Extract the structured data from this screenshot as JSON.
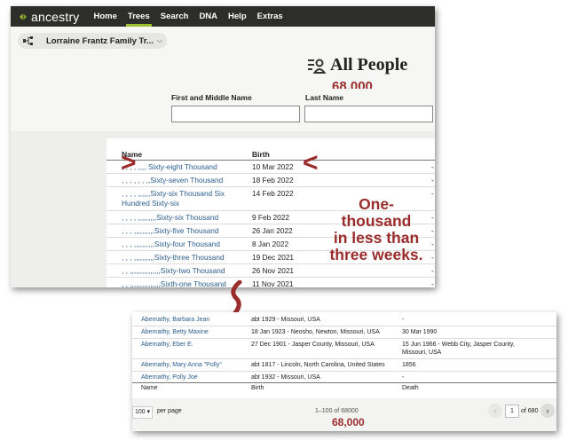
{
  "navbar": {
    "logo_text": "ancestry",
    "items": [
      "Home",
      "Trees",
      "Search",
      "DNA",
      "Help",
      "Extras"
    ],
    "active": "Trees"
  },
  "tree": {
    "name": "Lorraine Frantz Family Tr...",
    "chevron": "⌵"
  },
  "page": {
    "title": "All People",
    "count_annotation": "68,000"
  },
  "search": {
    "first_label": "First and Middle Name",
    "first_value": "",
    "last_label": "Last Name",
    "last_value": ""
  },
  "table": {
    "headers": {
      "name": "Name",
      "birth": "Birth",
      "death": ""
    },
    "rows": [
      {
        "name": ", , , , ,,,, Sixty-eight Thousand",
        "birth": "10 Mar 2022",
        "death": "-"
      },
      {
        "name": ", , , , , , ,,Sixty-seven Thousand",
        "birth": "18 Feb 2022",
        "death": "-"
      },
      {
        "name": ", , , , ,,,,,,Sixty-six Thousand Six Hundred Sixty-six",
        "birth": "14 Feb 2022",
        "death": "-"
      },
      {
        "name": ", , , , ,,,,,,,,,Sixty-six Thousand",
        "birth": "9 Feb 2022",
        "death": "-"
      },
      {
        "name": ", , , ,,,,,,,,,,Sixty-five Thousand",
        "birth": "26 Jan 2022",
        "death": "-"
      },
      {
        "name": ", , , ,,,,,,,,,,Sixty-four Thousand",
        "birth": "8 Jan 2022",
        "death": "-"
      },
      {
        "name": ", , , ,,,,,,,,,,Sixty-three Thousand",
        "birth": "19 Dec 2021",
        "death": "-"
      },
      {
        "name": ", , ,,,,,,,,,,,,,,,Sixty-two Thousand",
        "birth": "26 Nov 2021",
        "death": "-"
      },
      {
        "name": ", , ,,,,,,,,,,,,,,,Sixth-one Thousand",
        "birth": "11 Nov 2021",
        "death": "-"
      }
    ]
  },
  "annotations": {
    "arrow_left": ">",
    "arrow_right": "<",
    "message_lines": [
      "One-",
      "thousand",
      "in less than",
      "three weeks."
    ],
    "bottom_count": "68,000"
  },
  "bottom_table": {
    "rows": [
      {
        "name": "Abernathy, Barbara Jean",
        "birth": "abt 1929 - Missouri, USA",
        "death": "-"
      },
      {
        "name": "Abernathy, Betty Maxine",
        "birth": "18 Jan 1923 - Neosho, Newton, Missouri, USA",
        "death": "30 Mar 1990"
      },
      {
        "name": "Abernathy, Eber E.",
        "birth": "27 Dec 1901 - Jasper County, Missouri, USA",
        "death": "15 Jun 1966 - Webb City, Jasper County, Missouri, USA"
      },
      {
        "name": "Abernathy, Mary Anna \"Polly\"",
        "birth": "abt 1817 - Lincoln, North Carolina, United States",
        "death": "1856"
      },
      {
        "name": "Abernathy, Polly Joe",
        "birth": "abt 1932 - Missouri, USA",
        "death": "-"
      }
    ],
    "footer_headers": {
      "name": "Name",
      "birth": "Birth",
      "death": "Death"
    },
    "per_page_value": "100 ▾",
    "per_page_label": "per page",
    "range": "1–100 of 68000",
    "current_page": "1",
    "of_pages": "of 680",
    "prev": "‹",
    "next": "›"
  },
  "colors": {
    "navbar": "#2d2e2a",
    "accent": "#9cbe30",
    "link": "#2a5d8f",
    "annotation": "#9b2c2c"
  }
}
